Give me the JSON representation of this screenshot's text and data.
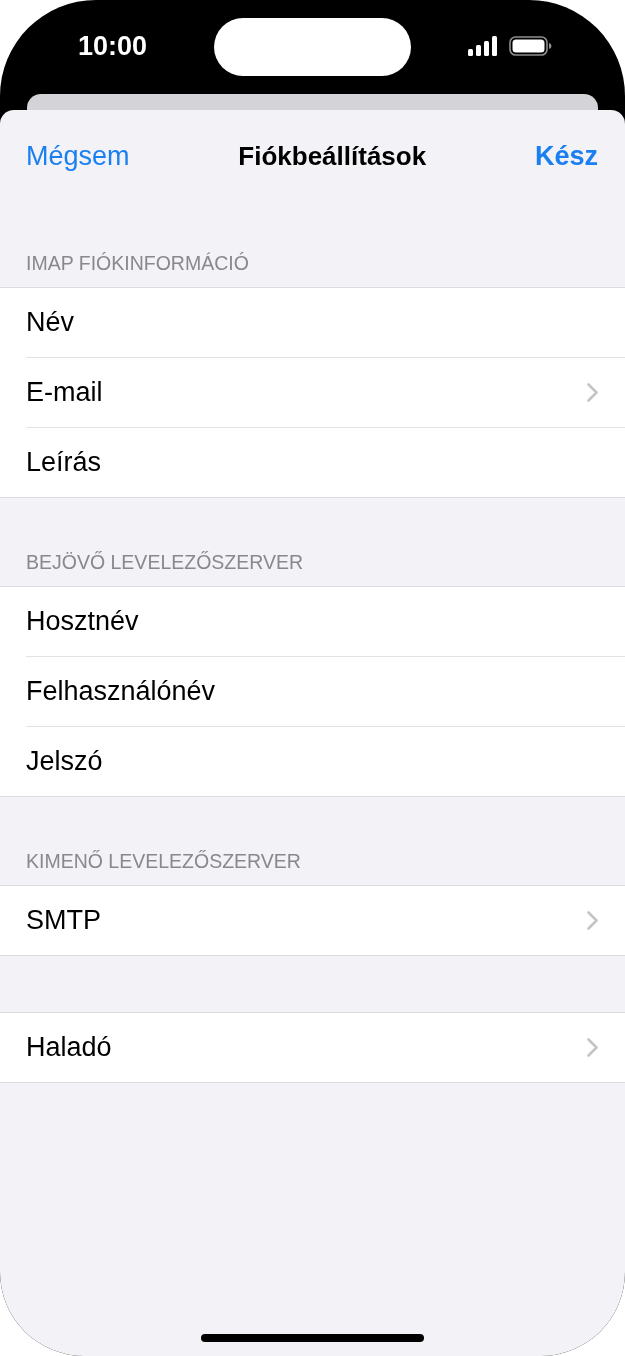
{
  "status_bar": {
    "time": "10:00"
  },
  "nav": {
    "cancel": "Mégsem",
    "title": "Fiókbeállítások",
    "done": "Kész"
  },
  "sections": [
    {
      "header": "IMAP FIÓKINFORMÁCIÓ",
      "rows": [
        {
          "label": "Név",
          "chevron": false
        },
        {
          "label": "E-mail",
          "chevron": true
        },
        {
          "label": "Leírás",
          "chevron": false
        }
      ]
    },
    {
      "header": "BEJÖVŐ LEVELEZŐSZERVER",
      "rows": [
        {
          "label": "Hosztnév",
          "chevron": false
        },
        {
          "label": "Felhasználónév",
          "chevron": false
        },
        {
          "label": "Jelszó",
          "chevron": false
        }
      ]
    },
    {
      "header": "KIMENŐ LEVELEZŐSZERVER",
      "rows": [
        {
          "label": "SMTP",
          "chevron": true
        }
      ]
    },
    {
      "rows": [
        {
          "label": "Haladó",
          "chevron": true
        }
      ]
    }
  ]
}
